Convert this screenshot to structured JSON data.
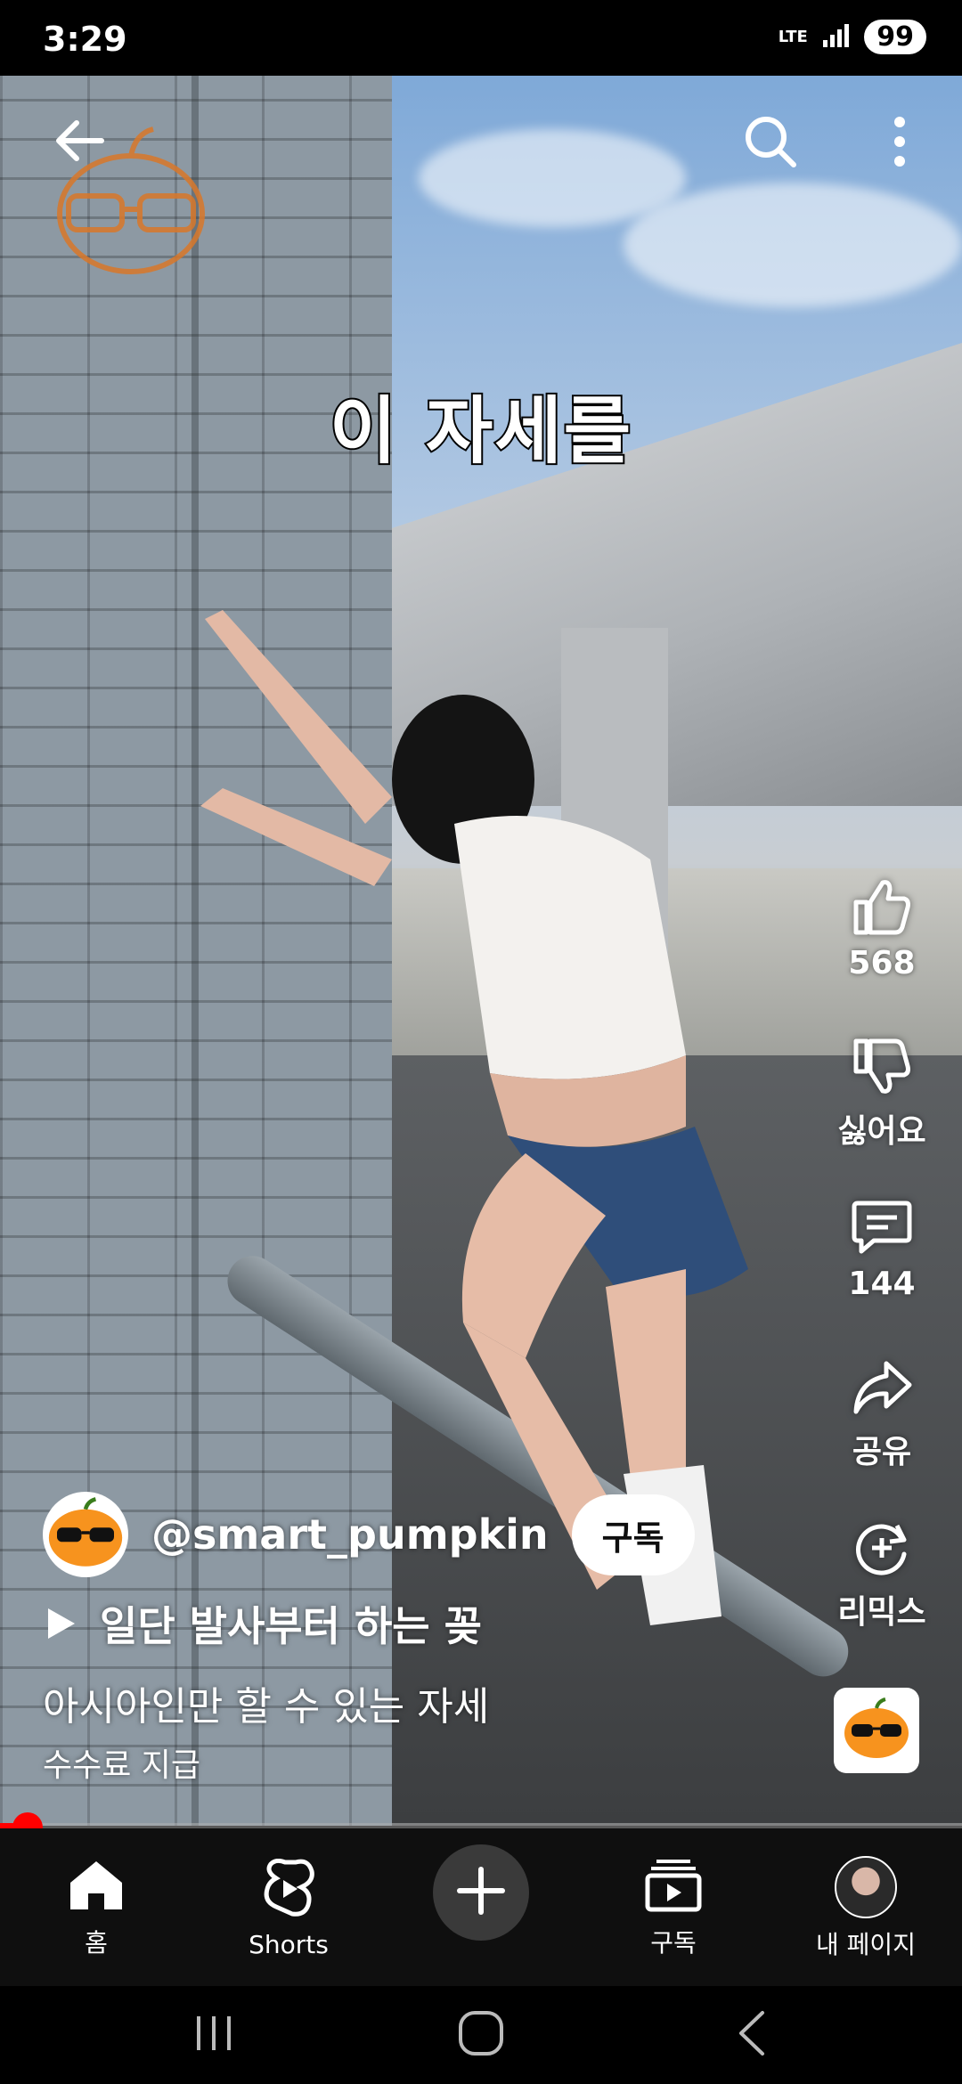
{
  "status_bar": {
    "time": "3:29",
    "network": "LTE",
    "battery": "99"
  },
  "video": {
    "caption_overlay": "이 자세를"
  },
  "top_bar": {
    "back_icon": "arrow-left-icon",
    "search_icon": "search-icon",
    "more_icon": "more-vertical-icon"
  },
  "actions": {
    "like_count": "568",
    "dislike_label": "싫어요",
    "comment_count": "144",
    "share_label": "공유",
    "remix_label": "리믹스"
  },
  "channel": {
    "name": "@smart_pumpkin",
    "subscribe_label": "구독"
  },
  "video_info": {
    "title": "일단 발사부터 하는 꽂",
    "description": "아시아인만 할 수 있는 자세",
    "sponsor_note": "수수료 지급"
  },
  "progress": {
    "fraction": 0.02
  },
  "bottom_nav": {
    "home": "홈",
    "shorts": "Shorts",
    "subscriptions": "구독",
    "my_page": "내 페이지"
  },
  "colors": {
    "accent": "#ff0000",
    "nav_background": "#0f0f0f",
    "pumpkin": "#f7931e"
  }
}
